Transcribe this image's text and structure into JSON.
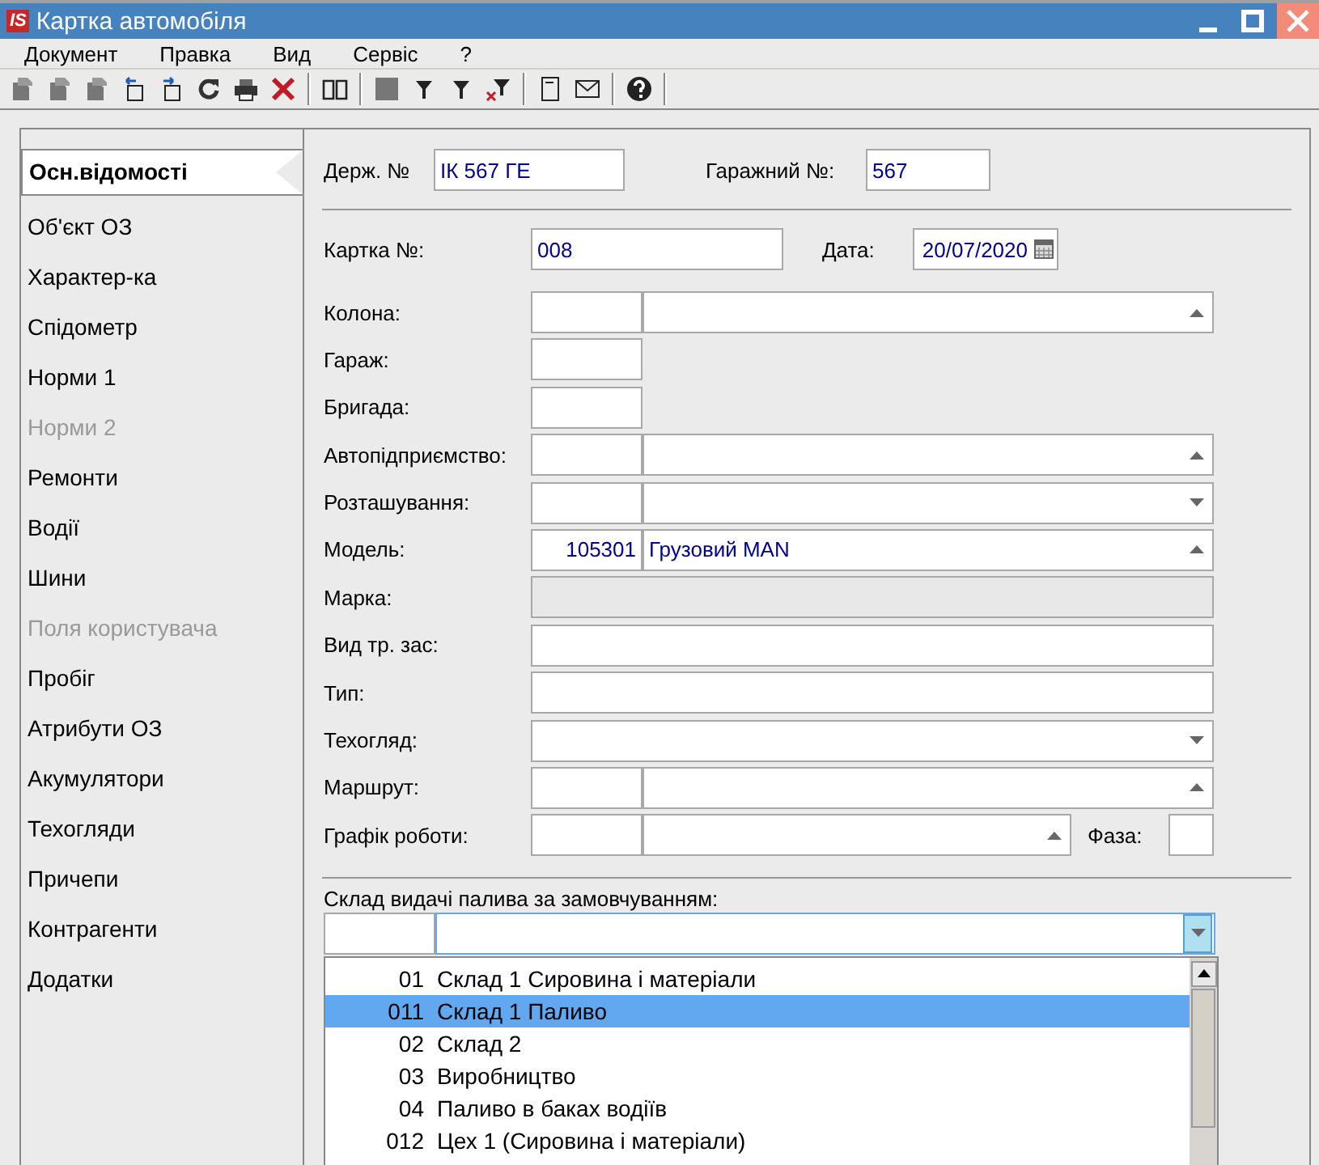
{
  "window": {
    "logo": "IS",
    "title": "Картка автомобіля"
  },
  "menu": [
    "Документ",
    "Правка",
    "Вид",
    "Сервіс",
    "?"
  ],
  "sidebar": {
    "items": [
      {
        "label": "Осн.відомості",
        "selected": true,
        "disabled": false
      },
      {
        "label": "Об'єкт ОЗ",
        "selected": false,
        "disabled": false
      },
      {
        "label": "Характер-ка",
        "selected": false,
        "disabled": false
      },
      {
        "label": "Спідометр",
        "selected": false,
        "disabled": false
      },
      {
        "label": "Норми 1",
        "selected": false,
        "disabled": false
      },
      {
        "label": "Норми 2",
        "selected": false,
        "disabled": true
      },
      {
        "label": "Ремонти",
        "selected": false,
        "disabled": false
      },
      {
        "label": "Водії",
        "selected": false,
        "disabled": false
      },
      {
        "label": "Шини",
        "selected": false,
        "disabled": false
      },
      {
        "label": "Поля користувача",
        "selected": false,
        "disabled": true
      },
      {
        "label": "Пробіг",
        "selected": false,
        "disabled": false
      },
      {
        "label": "Атрибути ОЗ",
        "selected": false,
        "disabled": false
      },
      {
        "label": "Акумулятори",
        "selected": false,
        "disabled": false
      },
      {
        "label": "Техогляди",
        "selected": false,
        "disabled": false
      },
      {
        "label": "Причепи",
        "selected": false,
        "disabled": false
      },
      {
        "label": "Контрагенти",
        "selected": false,
        "disabled": false
      },
      {
        "label": "Додатки",
        "selected": false,
        "disabled": false
      }
    ]
  },
  "header": {
    "state_no": {
      "label": "Держ. №",
      "value": "ІК 567 ГЕ"
    },
    "garage_no": {
      "label": "Гаражний №:",
      "value": "567"
    }
  },
  "card": {
    "label": "Картка №:",
    "value": "008"
  },
  "date": {
    "label": "Дата:",
    "value": "20/07/2020"
  },
  "fields": [
    {
      "kind": "split",
      "label": "Колона:",
      "opens_up": true
    },
    {
      "kind": "code",
      "label": "Гараж:"
    },
    {
      "kind": "code",
      "label": "Бригада:"
    },
    {
      "kind": "split",
      "label": "Автопідприємство:",
      "opens_up": true
    },
    {
      "kind": "split",
      "label": "Розташування:",
      "opens_up": false
    },
    {
      "kind": "split",
      "label": "Модель:",
      "code": "105301",
      "value": "Грузовий MAN",
      "opens_up": true
    },
    {
      "kind": "readonly",
      "label": "Марка:"
    },
    {
      "kind": "full",
      "label": "Вид тр. зас:"
    },
    {
      "kind": "full",
      "label": "Тип:"
    },
    {
      "kind": "select",
      "label": "Техогляд:",
      "opens_up": false
    },
    {
      "kind": "split",
      "label": "Маршрут:",
      "opens_up": true
    },
    {
      "kind": "phase",
      "label": "Графік роботи:",
      "opens_up": true,
      "phase_label": "Фаза:"
    }
  ],
  "fuel": {
    "label": "Склад видачі палива за замовчуванням:",
    "expanded": true,
    "options": [
      {
        "code": "01",
        "name": "Склад 1 Сировина і матеріали",
        "selected": false
      },
      {
        "code": "011",
        "name": "Склад 1 Паливо",
        "selected": true
      },
      {
        "code": "02",
        "name": "Склад 2",
        "selected": false
      },
      {
        "code": "03",
        "name": "Виробництво",
        "selected": false
      },
      {
        "code": "04",
        "name": "Паливо в баках водіїв",
        "selected": false
      },
      {
        "code": "012",
        "name": "Цех 1 (Сировина і матеріали)",
        "selected": false
      }
    ]
  }
}
